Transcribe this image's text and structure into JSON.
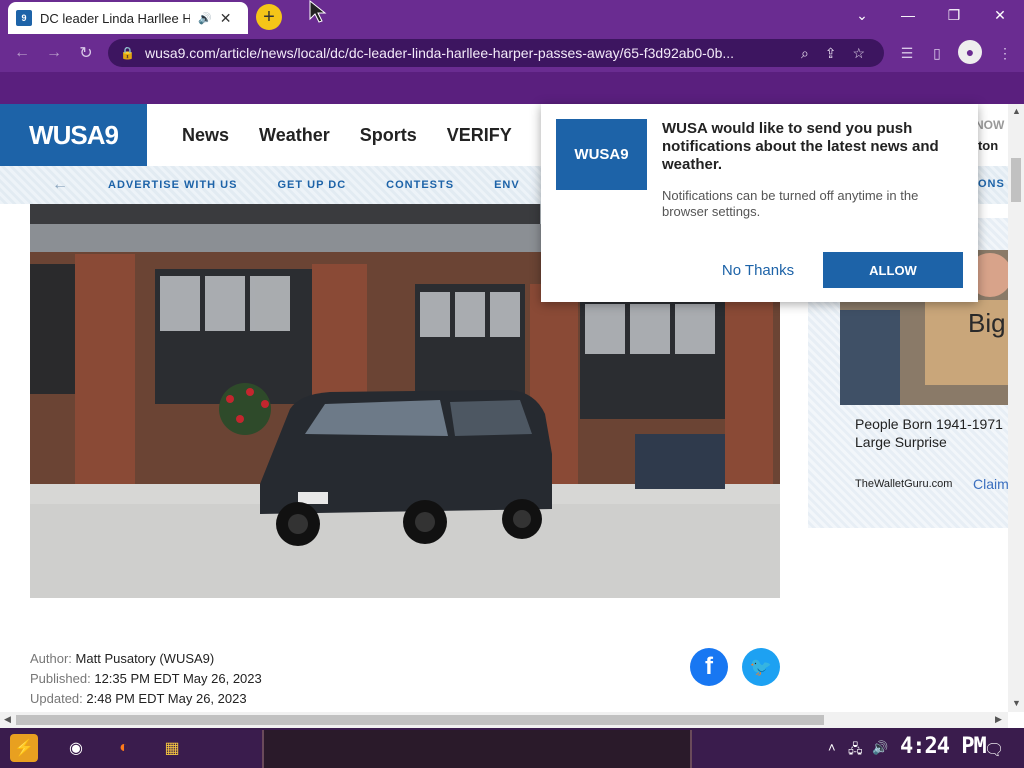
{
  "browser": {
    "tab_title": "DC leader Linda Harllee He",
    "url": "wusa9.com/article/news/local/dc/dc-leader-linda-harllee-harper-passes-away/65-f3d92ab0-0b..."
  },
  "site": {
    "logo": "WUSA9",
    "nav": [
      "News",
      "Weather",
      "Sports",
      "VERIFY"
    ],
    "now_tag": "NOW",
    "city_tag": "gton",
    "subnav": [
      "ADVERTISE WITH US",
      "GET UP DC",
      "CONTESTS",
      "ENV"
    ],
    "subnav_right": "ONS"
  },
  "popup": {
    "logo": "WUSA9",
    "title": "WUSA would like to send you push notifications about the latest news and weather.",
    "note": "Notifications can be turned off anytime in the browser settings.",
    "no_thanks": "No Thanks",
    "allow": "ALLOW"
  },
  "ad": {
    "headline": "People Born 1941-1971 Large Surprise",
    "source": "TheWalletGuru.com",
    "cta": "Claim",
    "sign_text": "Big PAY"
  },
  "byline": {
    "author_label": "Author:",
    "author": "Matt Pusatory (WUSA9)",
    "published_label": "Published:",
    "published": "12:35 PM EDT May 26, 2023",
    "updated_label": "Updated:",
    "updated": "2:48 PM EDT May 26, 2023"
  },
  "taskbar": {
    "clock": "4:24 PM"
  }
}
